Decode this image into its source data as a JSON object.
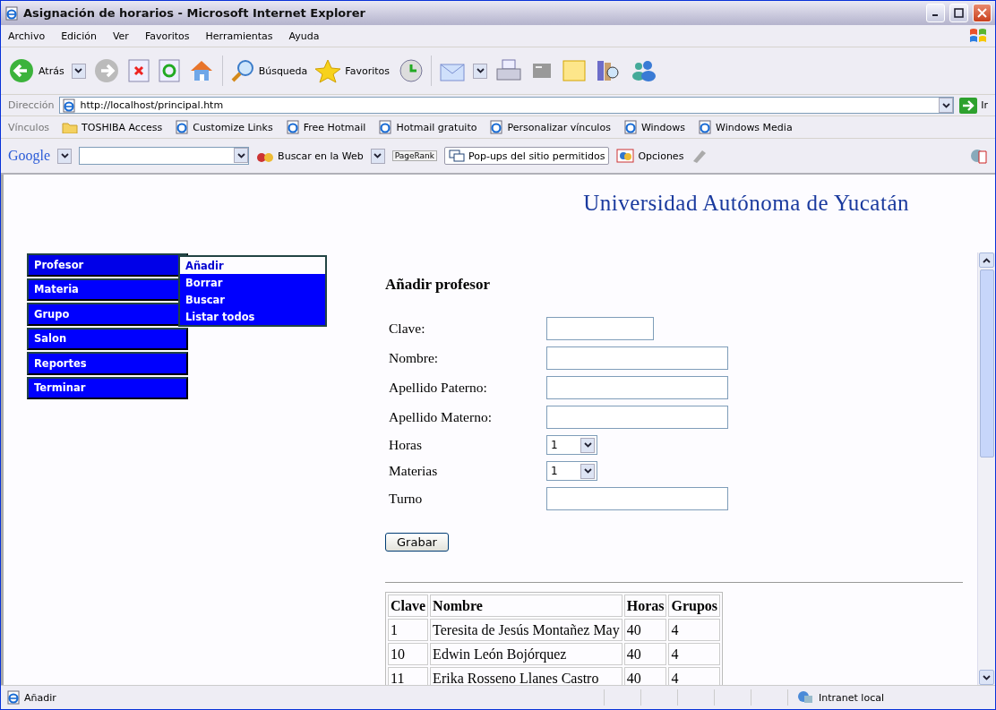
{
  "window": {
    "title": "Asignación de horarios - Microsoft Internet Explorer"
  },
  "menu_bar": [
    "Archivo",
    "Edición",
    "Ver",
    "Favoritos",
    "Herramientas",
    "Ayuda"
  ],
  "toolbar": {
    "back": "Atrás",
    "search": "Búsqueda",
    "favorites": "Favoritos"
  },
  "address_bar": {
    "label": "Dirección",
    "url": "http://localhost/principal.htm",
    "go": "Ir"
  },
  "links_bar": {
    "label": "Vínculos",
    "items": [
      {
        "label": "TOSHIBA Access",
        "kind": "folder"
      },
      {
        "label": "Customize Links",
        "kind": "page"
      },
      {
        "label": "Free Hotmail",
        "kind": "page"
      },
      {
        "label": "Hotmail gratuito",
        "kind": "page"
      },
      {
        "label": "Personalizar vínculos",
        "kind": "page"
      },
      {
        "label": "Windows",
        "kind": "page"
      },
      {
        "label": "Windows Media",
        "kind": "page"
      }
    ]
  },
  "google_bar": {
    "logo": "Google",
    "search_button": "Buscar en la Web",
    "pagerank": "PageRank",
    "popups": "Pop-ups del sitio permitidos",
    "options": "Opciones"
  },
  "page": {
    "heading": "Universidad Autónoma de Yucatán",
    "nav": [
      {
        "label": "Profesor",
        "expanded": true,
        "children": [
          {
            "label": "Añadir",
            "selected": true
          },
          {
            "label": "Borrar",
            "selected": false
          },
          {
            "label": "Buscar",
            "selected": false
          },
          {
            "label": "Listar todos",
            "selected": false
          }
        ]
      },
      {
        "label": "Materia",
        "expanded": false
      },
      {
        "label": "Grupo",
        "expanded": false
      },
      {
        "label": "Salon",
        "expanded": false
      },
      {
        "label": "Reportes",
        "expanded": false
      },
      {
        "label": "Terminar",
        "expanded": false
      }
    ],
    "form": {
      "title": "Añadir profesor",
      "fields": [
        {
          "label": "Clave:",
          "kind": "short"
        },
        {
          "label": "Nombre:",
          "kind": "text"
        },
        {
          "label": "Apellido Paterno:",
          "kind": "text"
        },
        {
          "label": "Apellido Materno:",
          "kind": "text"
        },
        {
          "label": "Horas",
          "kind": "select",
          "value": "1"
        },
        {
          "label": "Materias",
          "kind": "select",
          "value": "1"
        },
        {
          "label": "Turno",
          "kind": "text"
        }
      ],
      "submit": "Grabar"
    },
    "table": {
      "columns": [
        "Clave",
        "Nombre",
        "Horas",
        "Grupos"
      ],
      "rows": [
        [
          "1",
          "Teresita de Jesús Montañez May",
          "40",
          "4"
        ],
        [
          "10",
          "Edwin León Bojórquez",
          "40",
          "4"
        ],
        [
          "11",
          "Erika Rosseno Llanes Castro",
          "40",
          "4"
        ]
      ]
    }
  },
  "status_bar": {
    "text": "Añadir",
    "zone": "Intranet local"
  }
}
